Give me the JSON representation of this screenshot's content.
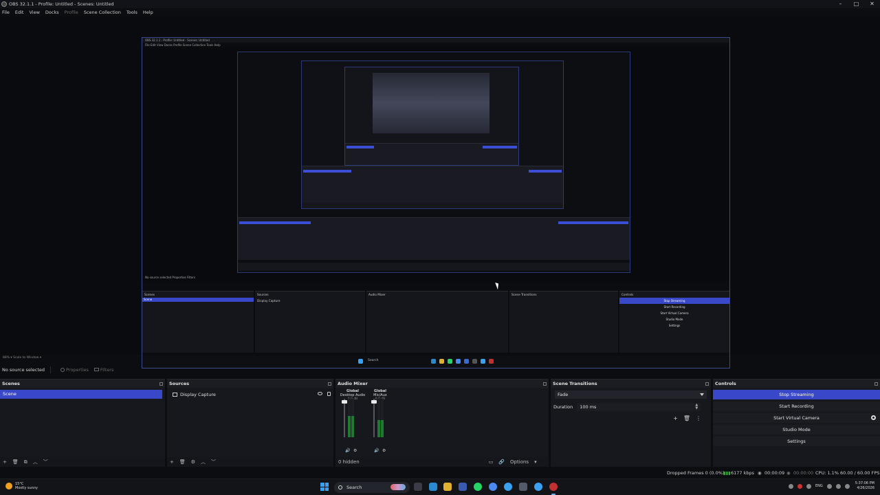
{
  "window": {
    "title": "OBS 32.1.1 - Profile: Untitled - Scenes: Untitled",
    "minimize": "–",
    "maximize": "□",
    "close": "✕"
  },
  "menu": [
    "File",
    "Edit",
    "View",
    "Docks",
    "Profile",
    "Scene Collection",
    "Tools",
    "Help"
  ],
  "preview": {
    "nested_title": "OBS 32.1.1 - Profile: Untitled - Scenes: Untitled",
    "nested_menu": "File  Edit  View  Docks  Profile  Scene Collection  Tools  Help",
    "nested_status": "No source selected      Properties   Filters",
    "scale_text": "88%  ▾    Scale to Window  ▾"
  },
  "context": {
    "no_source": "No source selected",
    "properties": "Properties",
    "filters": "Filters"
  },
  "scenes": {
    "title": "Scenes",
    "items": [
      "Scene"
    ],
    "footer": [
      "+",
      "🗑",
      "⧉",
      "︿",
      "﹀"
    ]
  },
  "sources": {
    "title": "Sources",
    "items": [
      {
        "name": "Display Capture"
      }
    ],
    "footer": [
      "+",
      "🗑",
      "⚙",
      "︿",
      "﹀"
    ]
  },
  "audio_mixer": {
    "title": "Audio Mixer",
    "channels": [
      {
        "scope": "Global",
        "name": "Desktop Audio",
        "db": "0.0 dB",
        "level": 0.55
      },
      {
        "scope": "Global",
        "name": "Mic/Aux",
        "db": "0.0 dB",
        "level": 0.45
      }
    ],
    "hidden": "0 hidden",
    "options": "Options"
  },
  "transitions": {
    "title": "Scene Transitions",
    "selected": "Fade",
    "duration_label": "Duration",
    "duration_value": "100 ms"
  },
  "controls": {
    "title": "Controls",
    "buttons": [
      "Stop Streaming",
      "Start Recording",
      "Start Virtual Camera",
      "Studio Mode",
      "Settings"
    ]
  },
  "status": {
    "dropped": "Dropped Frames 0 (0.0%)",
    "bitrate": "6177 kbps",
    "stream_time": "00:00:09",
    "rec_time": "00:00:00",
    "cpu": "CPU: 1.1%",
    "fps": "60.00 / 60.00 FPS"
  },
  "taskbar": {
    "temp": "15°C",
    "weather": "Mostly sunny",
    "search": "Search",
    "lang": "ENG",
    "time": "5:37:06 PM",
    "date": "4/26/2026"
  },
  "colors": {
    "accent": "#3848c8",
    "bg": "#17181d"
  }
}
